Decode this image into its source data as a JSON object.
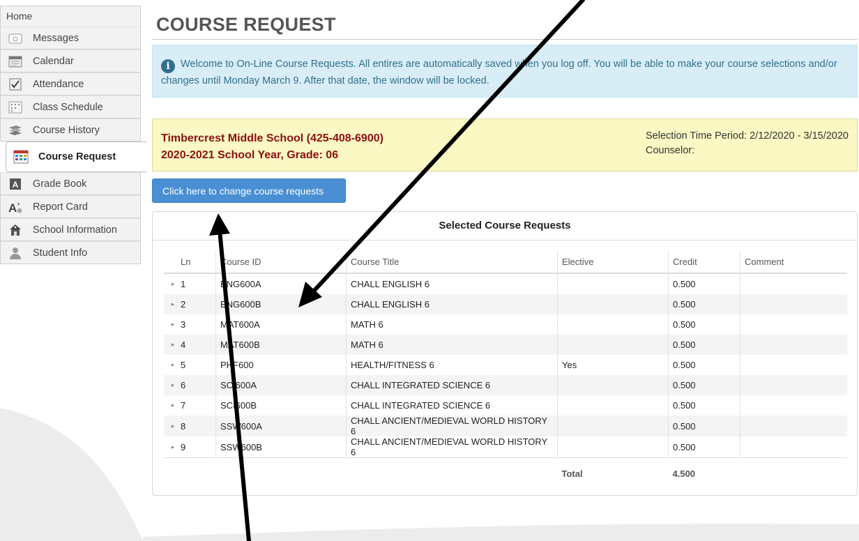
{
  "sidebar": {
    "home_label": "Home",
    "items": [
      {
        "label": "Messages",
        "icon": "envelope-icon"
      },
      {
        "label": "Calendar",
        "icon": "calendar-icon"
      },
      {
        "label": "Attendance",
        "icon": "attendance-checkbox-icon"
      },
      {
        "label": "Class Schedule",
        "icon": "schedule-grid-icon"
      },
      {
        "label": "Course History",
        "icon": "books-stack-icon"
      },
      {
        "label": "Course Request",
        "icon": "course-request-grid-icon",
        "active": true
      },
      {
        "label": "Grade Book",
        "icon": "gradebook-icon"
      },
      {
        "label": "Report Card",
        "icon": "a-plus-icon"
      },
      {
        "label": "School Information",
        "icon": "schoolhouse-icon"
      },
      {
        "label": "Student Info",
        "icon": "person-icon"
      }
    ]
  },
  "main": {
    "title": "COURSE REQUEST",
    "info_text": "Welcome to On-Line Course Requests. All entires are automatically saved when you log off. You will be able to make your course selections and/or changes until Monday March 9. After that date, the window will be locked.",
    "school": {
      "name_line": "Timbercrest Middle School (425-408-6900)",
      "year_line": "2020-2021 School Year, Grade: 06",
      "period_line": "Selection Time Period: 2/12/2020 - 3/15/2020",
      "counselor_line": "Counselor:"
    },
    "change_button_label": "Click here to change course requests",
    "panel_title": "Selected Course Requests",
    "table": {
      "headers": [
        "Ln",
        "Course ID",
        "Course Title",
        "Elective",
        "Credit",
        "Comment"
      ],
      "rows": [
        {
          "ln": "1",
          "id": "ENG600A",
          "title": "CHALL ENGLISH 6",
          "elective": "",
          "credit": "0.500",
          "comment": ""
        },
        {
          "ln": "2",
          "id": "ENG600B",
          "title": "CHALL ENGLISH 6",
          "elective": "",
          "credit": "0.500",
          "comment": ""
        },
        {
          "ln": "3",
          "id": "MAT600A",
          "title": "MATH 6",
          "elective": "",
          "credit": "0.500",
          "comment": ""
        },
        {
          "ln": "4",
          "id": "MAT600B",
          "title": "MATH 6",
          "elective": "",
          "credit": "0.500",
          "comment": ""
        },
        {
          "ln": "5",
          "id": "PHF600",
          "title": "HEALTH/FITNESS 6",
          "elective": "Yes",
          "credit": "0.500",
          "comment": ""
        },
        {
          "ln": "6",
          "id": "SCI600A",
          "title": "CHALL INTEGRATED SCIENCE 6",
          "elective": "",
          "credit": "0.500",
          "comment": ""
        },
        {
          "ln": "7",
          "id": "SCI600B",
          "title": "CHALL INTEGRATED SCIENCE 6",
          "elective": "",
          "credit": "0.500",
          "comment": ""
        },
        {
          "ln": "8",
          "id": "SSW600A",
          "title": "CHALL ANCIENT/MEDIEVAL WORLD HISTORY 6",
          "elective": "",
          "credit": "0.500",
          "comment": ""
        },
        {
          "ln": "9",
          "id": "SSW600B",
          "title": "CHALL ANCIENT/MEDIEVAL WORLD HISTORY 6",
          "elective": "",
          "credit": "0.500",
          "comment": ""
        }
      ],
      "total_label": "Total",
      "total_value": "4.500"
    }
  },
  "colors": {
    "info_bg": "#d9edf7",
    "info_text": "#31708f",
    "school_bg": "#fbf8c4",
    "school_text": "#8b1010",
    "button_bg": "#4a8fd4"
  }
}
